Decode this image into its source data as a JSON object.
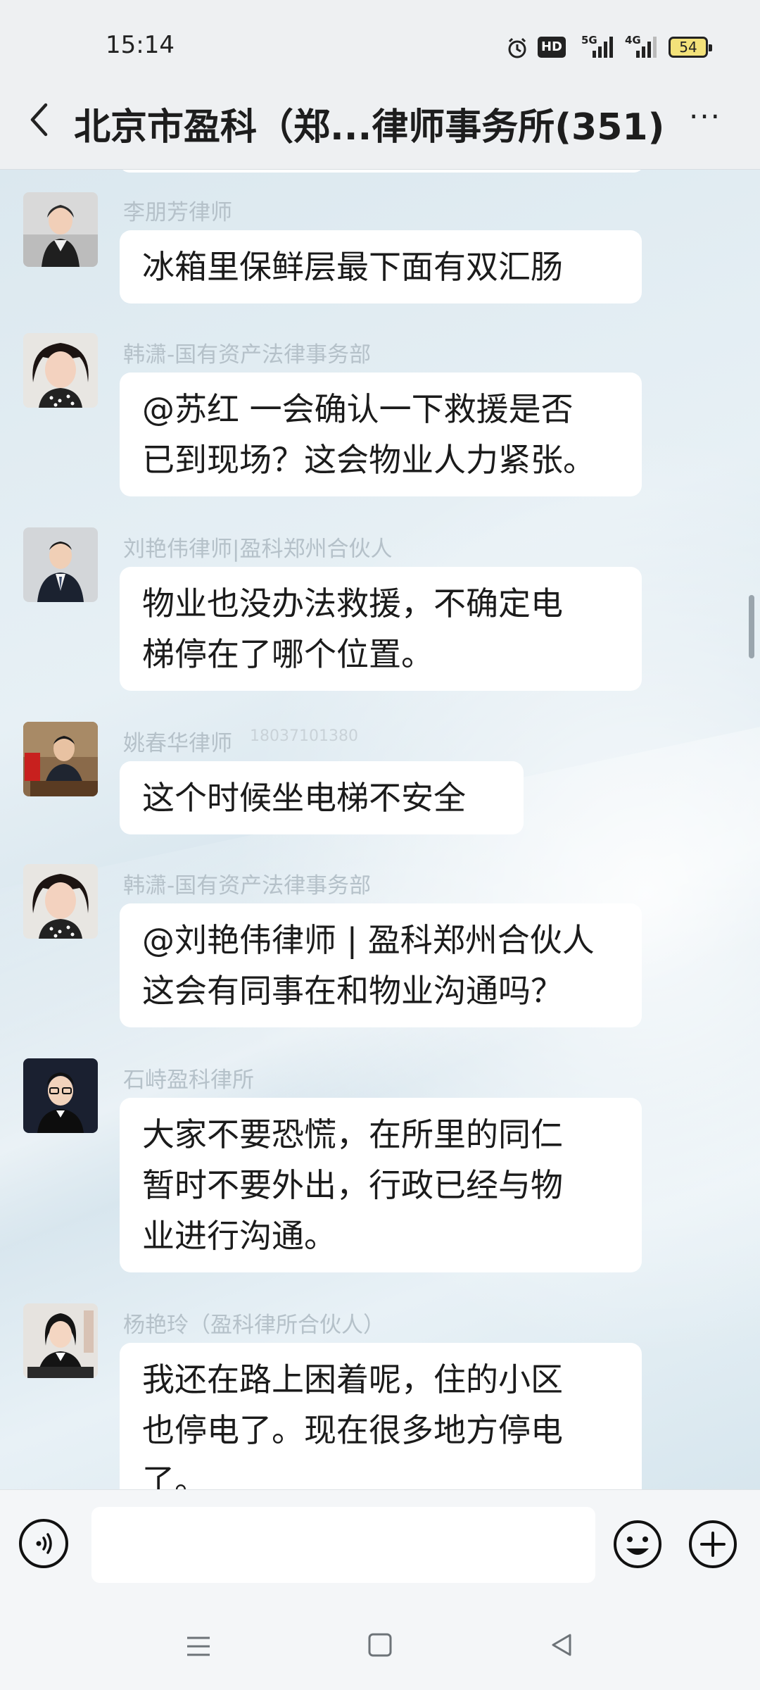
{
  "status": {
    "time": "15:14",
    "hd_label": "HD",
    "net1": "5G",
    "net2": "4G",
    "battery": "54",
    "icons": [
      "alarm-icon",
      "hd-voice-icon",
      "signal-5g-icon",
      "signal-4g-icon",
      "battery-icon"
    ]
  },
  "header": {
    "title": "北京市盈科（郑...律师事务所(351)",
    "back_icon": "back-arrow-icon",
    "more_icon": "more-icon",
    "more_label": "···"
  },
  "messages": [
    {
      "sender": "李朋芳律师",
      "lines": [
        "冰箱里保鲜层最下面有双汇肠"
      ],
      "avatar": "avatar-1"
    },
    {
      "sender": "韩潇-国有资产法律事务部",
      "lines": [
        "@苏红  一会确认一下救援是否",
        "已到现场？这会物业人力紧张。"
      ],
      "avatar": "avatar-2"
    },
    {
      "sender": "刘艳伟律师|盈科郑州合伙人",
      "lines": [
        "物业也没办法救援，不确定电",
        "梯停在了哪个位置。"
      ],
      "avatar": "avatar-3"
    },
    {
      "sender": "姚春华律师",
      "sender_extra": "18037101380",
      "lines": [
        "这个时候坐电梯不安全"
      ],
      "avatar": "avatar-4"
    },
    {
      "sender": "韩潇-国有资产法律事务部",
      "lines": [
        "@刘艳伟律师 | 盈科郑州合伙人",
        " 这会有同事在和物业沟通吗？"
      ],
      "avatar": "avatar-5"
    },
    {
      "sender": "石峙盈科律所",
      "lines": [
        "大家不要恐慌，在所里的同仁",
        "暂时不要外出，行政已经与物",
        "业进行沟通。"
      ],
      "avatar": "avatar-6"
    },
    {
      "sender": "杨艳玲（盈科律所合伙人）",
      "lines": [
        "我还在路上困着呢，住的小区",
        "也停电了。现在很多地方停电",
        "了。"
      ],
      "avatar": "avatar-7"
    }
  ],
  "input": {
    "placeholder": "",
    "voice_icon": "voice-icon",
    "emoji_icon": "emoji-icon",
    "add_icon": "add-icon"
  },
  "nav": {
    "icons": [
      "menu-nav-icon",
      "home-nav-icon",
      "back-nav-icon"
    ]
  },
  "colors": {
    "bubble": "#ffffff",
    "sender_text": "#b5c1c9",
    "message_text": "#1b1b1b",
    "header_bg": "#eef0f2",
    "battery_fill": "#f3e27a"
  }
}
